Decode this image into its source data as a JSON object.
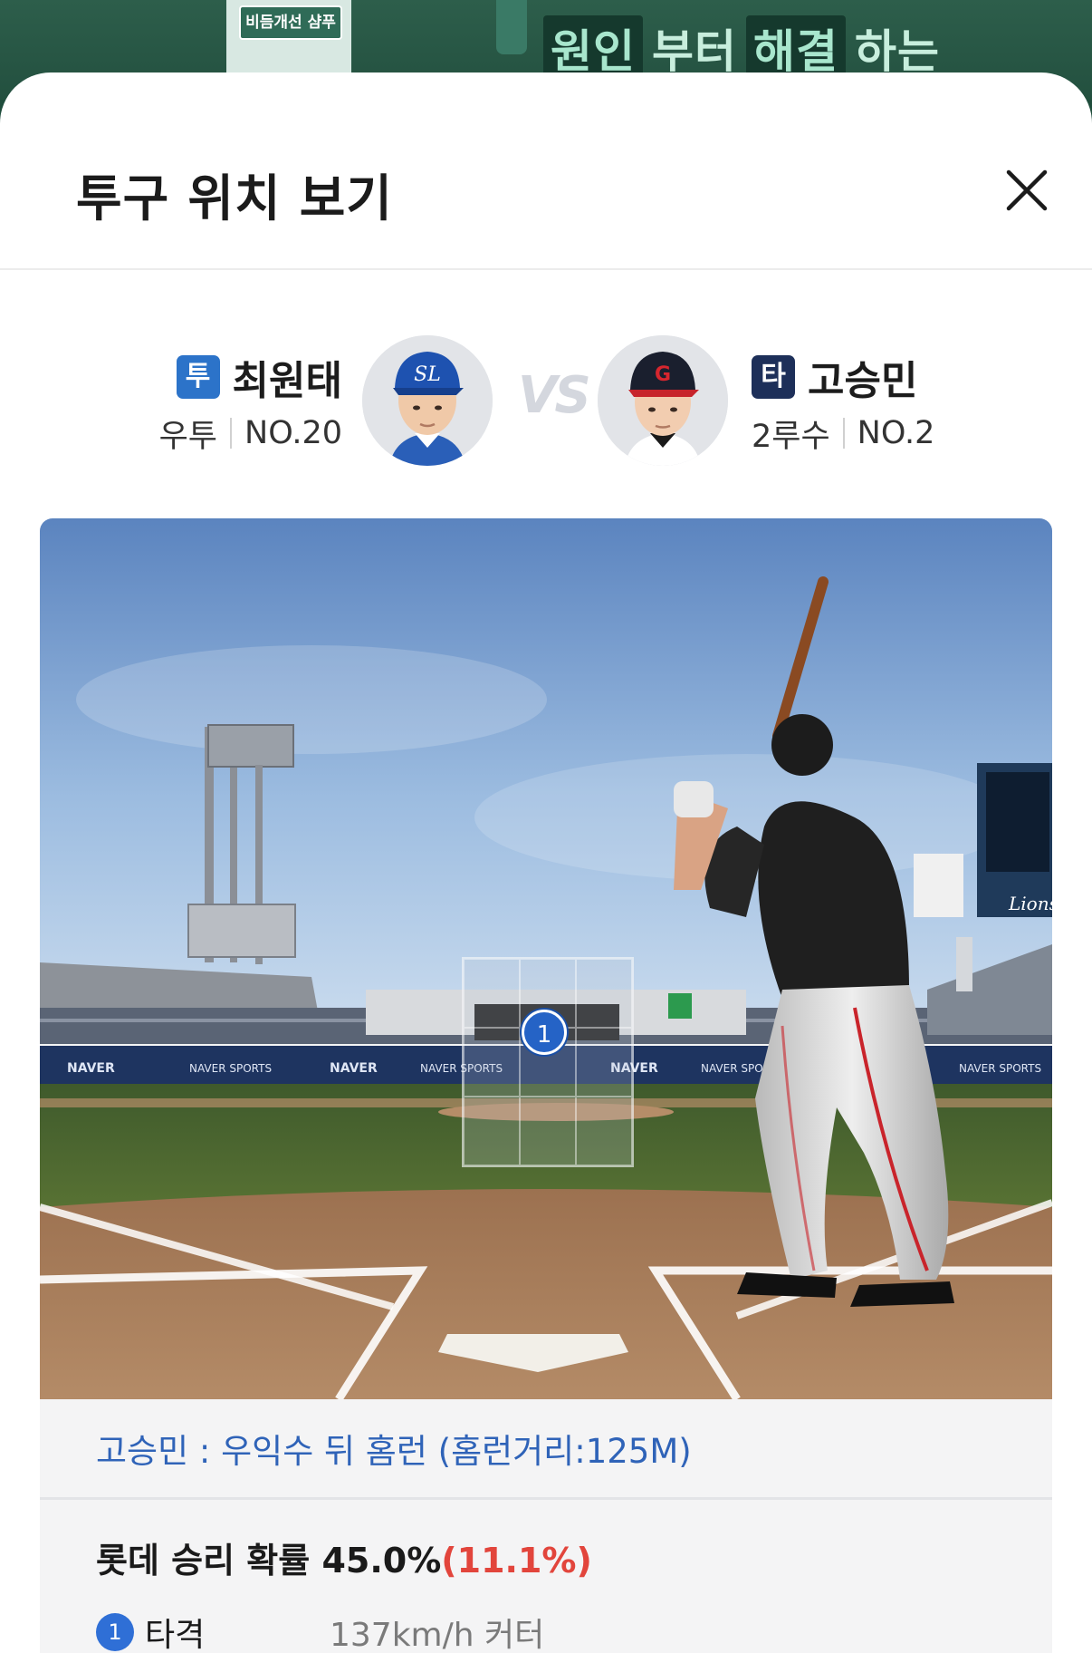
{
  "ad": {
    "product_label": "비듬개선 샴푸",
    "headline_parts": [
      "원인",
      "부터",
      "해결",
      "하는"
    ]
  },
  "sheet": {
    "title": "투구 위치 보기"
  },
  "matchup": {
    "pitcher": {
      "badge": "투",
      "name": "최원태",
      "position": "우투",
      "number": "NO.20",
      "cap_logo": "SL"
    },
    "vs": "VS",
    "batter": {
      "badge": "타",
      "name": "고승민",
      "position": "2루수",
      "number": "NO.2",
      "cap_logo": "G"
    }
  },
  "scene": {
    "stadium_ads": [
      "NAVER",
      "NAVER SPORTS",
      "NAVER",
      "NAVER SPORTS",
      "NAVER",
      "NAVER SPORTS",
      "NAVER SPORTS"
    ],
    "scoreboard_team": "Lions",
    "pitch_marker": "1"
  },
  "result": {
    "text": "고승민 : 우익수 뒤 홈런 (홈런거리:125M)"
  },
  "win_probability": {
    "label": "롯데 승리 확률 45.0%",
    "change": "(11.1%)"
  },
  "pitches": [
    {
      "num": "1",
      "result": "타격",
      "detail": "137km/h 커터"
    }
  ],
  "colors": {
    "pitcher_badge": "#2c73c9",
    "batter_badge": "#1d2f59",
    "result_text": "#2f63b8",
    "change_red": "#e2453c",
    "pitch_marker": "#2563c6"
  }
}
